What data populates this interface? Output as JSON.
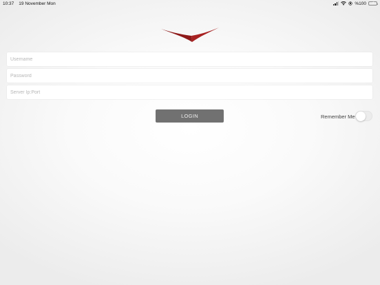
{
  "status_bar": {
    "time": "10:37",
    "date": "19 November Mon",
    "battery_text": "%100",
    "battery_level": 1.0,
    "battery_color": "#4cd964",
    "icons": [
      "cellular-signal-icon",
      "wifi-icon",
      "location-lock-icon",
      "battery-icon"
    ]
  },
  "logo": {
    "color": "#8e1a1a",
    "icon": "chevron-wings-logo"
  },
  "form": {
    "username": {
      "value": "",
      "placeholder": "Username"
    },
    "password": {
      "value": "",
      "placeholder": "Password"
    },
    "server": {
      "value": "",
      "placeholder": "Server Ip:Port"
    },
    "login_label": "LOGIN",
    "login_color": "#717171",
    "remember": {
      "label": "Remember Me",
      "checked": false
    }
  }
}
